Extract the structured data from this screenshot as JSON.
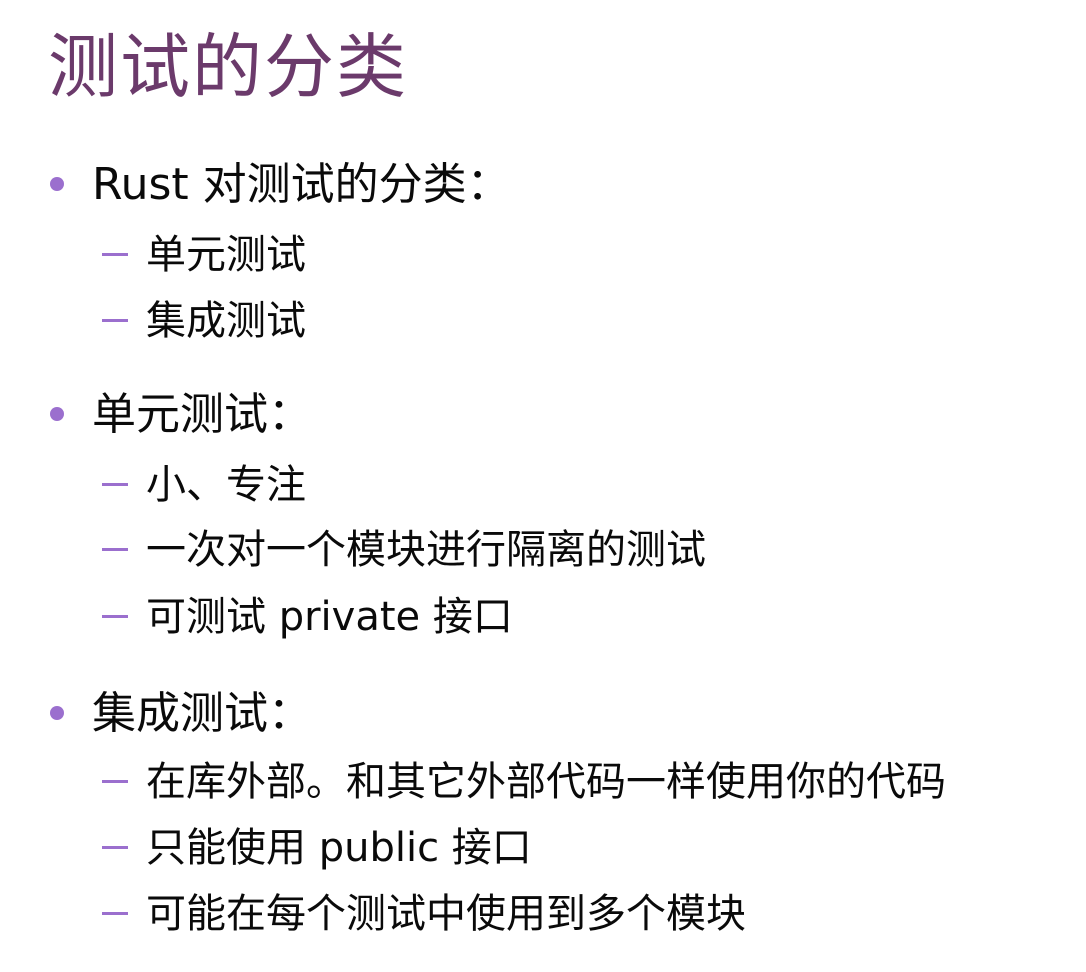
{
  "title": "测试的分类",
  "sections": [
    {
      "heading": "Rust 对测试的分类：",
      "items": [
        "单元测试",
        "集成测试"
      ]
    },
    {
      "heading": "单元测试：",
      "items": [
        "小、专注",
        "一次对一个模块进行隔离的测试",
        "可测试 private 接口"
      ]
    },
    {
      "heading": "集成测试：",
      "items": [
        "在库外部。和其它外部代码一样使用你的代码",
        "只能使用 public 接口",
        "可能在每个测试中使用到多个模块"
      ]
    }
  ],
  "colors": {
    "title": "#6b3a6b",
    "bullet": "#9b6fce",
    "text": "#0a0a0a"
  }
}
